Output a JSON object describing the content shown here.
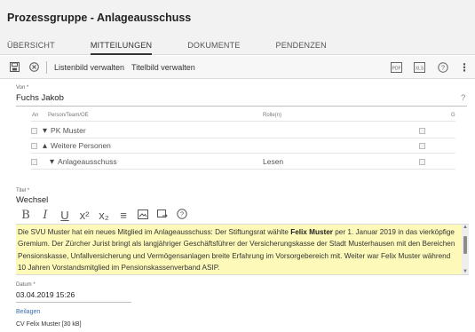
{
  "header": {
    "title": "Prozessgruppe - Anlageausschuss",
    "tabs": [
      {
        "label": "ÜBERSICHT"
      },
      {
        "label": "MITTEILUNGEN"
      },
      {
        "label": "DOKUMENTE"
      },
      {
        "label": "PENDENZEN"
      }
    ]
  },
  "toolbar": {
    "save_icon": "save-icon",
    "cancel_icon": "cancel-icon",
    "listenbild_label": "Listenbild verwalten",
    "titelbild_label": "Titelbild verwalten",
    "pdf_label": "PDF",
    "xls_label": "XLS",
    "help_glyph": "?",
    "more_glyph": "⋮"
  },
  "von": {
    "label": "Von *",
    "value": "Fuchs Jakob",
    "help": "?"
  },
  "table": {
    "col_an": "An",
    "col_person": "Person/Team/OE",
    "col_rolle": "Rolle(n)",
    "col_g": "G",
    "rows": [
      {
        "name": "PK Muster",
        "role": "",
        "toggle": "▾"
      },
      {
        "name": "Weitere Personen",
        "role": "",
        "toggle": "▴"
      },
      {
        "name": "Anlageausschuss",
        "role": "Lesen",
        "toggle": "▾"
      }
    ]
  },
  "titel": {
    "label": "Titel *",
    "value": "Wechsel"
  },
  "editor": {
    "bold": "B",
    "italic": "I",
    "underline": "U",
    "superscript": "x²",
    "subscript": "x₂",
    "list": "≡",
    "image_icon": "image-icon",
    "link_icon": "link-icon",
    "help": "?"
  },
  "content": {
    "part1": "Die SVU Muster hat ein neues Mitglied im Anlageausschuss: Der Stiftungsrat wählte ",
    "bold": "Felix Muster",
    "part2": " per 1. Januar 2019 in das vierköpfige Gremium. Der Zürcher Jurist bringt als langjähriger Geschäftsführer der Versicherungskasse der Stadt Musterhausen mit den Bereichen Pensionskasse, Unfallversicherung und Vermögensanlagen breite Erfahrung im Vorsorgebereich mit. Weiter war Felix Muster während 10 Jahren Vorstandsmitglied im Pensionskassenverband ASIP."
  },
  "datum": {
    "label": "Datum *",
    "value": "03.04.2019 15:26"
  },
  "beilagen": {
    "label": "Beilagen",
    "file": "CV Felix Muster [30 kB]"
  }
}
